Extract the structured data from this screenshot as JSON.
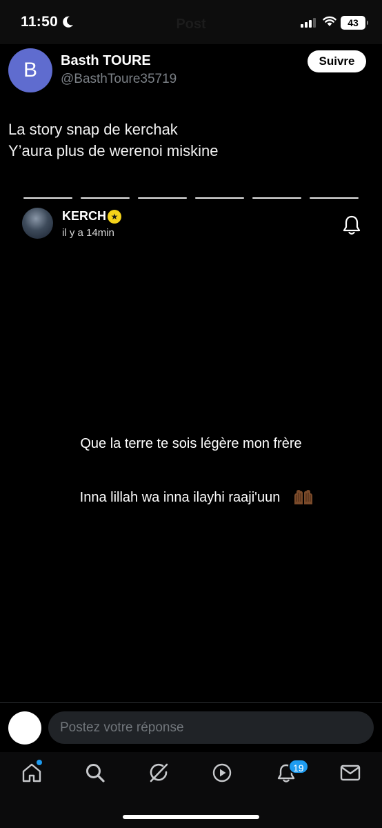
{
  "status_bar": {
    "time": "11:50",
    "screen_title": "Post",
    "battery": "43"
  },
  "post": {
    "author": {
      "initial": "B",
      "name": "Basth TOURE",
      "handle": "@BasthToure35719",
      "avatar_color": "#5f6ccf"
    },
    "follow_label": "Suivre",
    "text_lines": [
      "La story snap de kerchak",
      "Y’aura plus de werenoi miskine"
    ]
  },
  "story": {
    "progress_segments": 6,
    "username": "KERCH",
    "badge_icon": "star-icon",
    "time": "il y a 14min",
    "lines": [
      "Que la terre te sois légère mon frère",
      "Inna lillah wa inna ilayhi raaji'uun"
    ],
    "emoji_icon": "raising-hands-icon"
  },
  "reply": {
    "placeholder": "Postez votre réponse"
  },
  "bottom_nav": {
    "items": [
      {
        "icon": "home-icon"
      },
      {
        "icon": "search-icon"
      },
      {
        "icon": "grok-icon"
      },
      {
        "icon": "play-icon"
      },
      {
        "icon": "bell-icon"
      },
      {
        "icon": "mail-icon"
      }
    ],
    "notifications_count": "19"
  },
  "colors": {
    "accent": "#1d9bf0",
    "badge_yellow": "#f4d21a",
    "muted_text": "#71767b"
  }
}
